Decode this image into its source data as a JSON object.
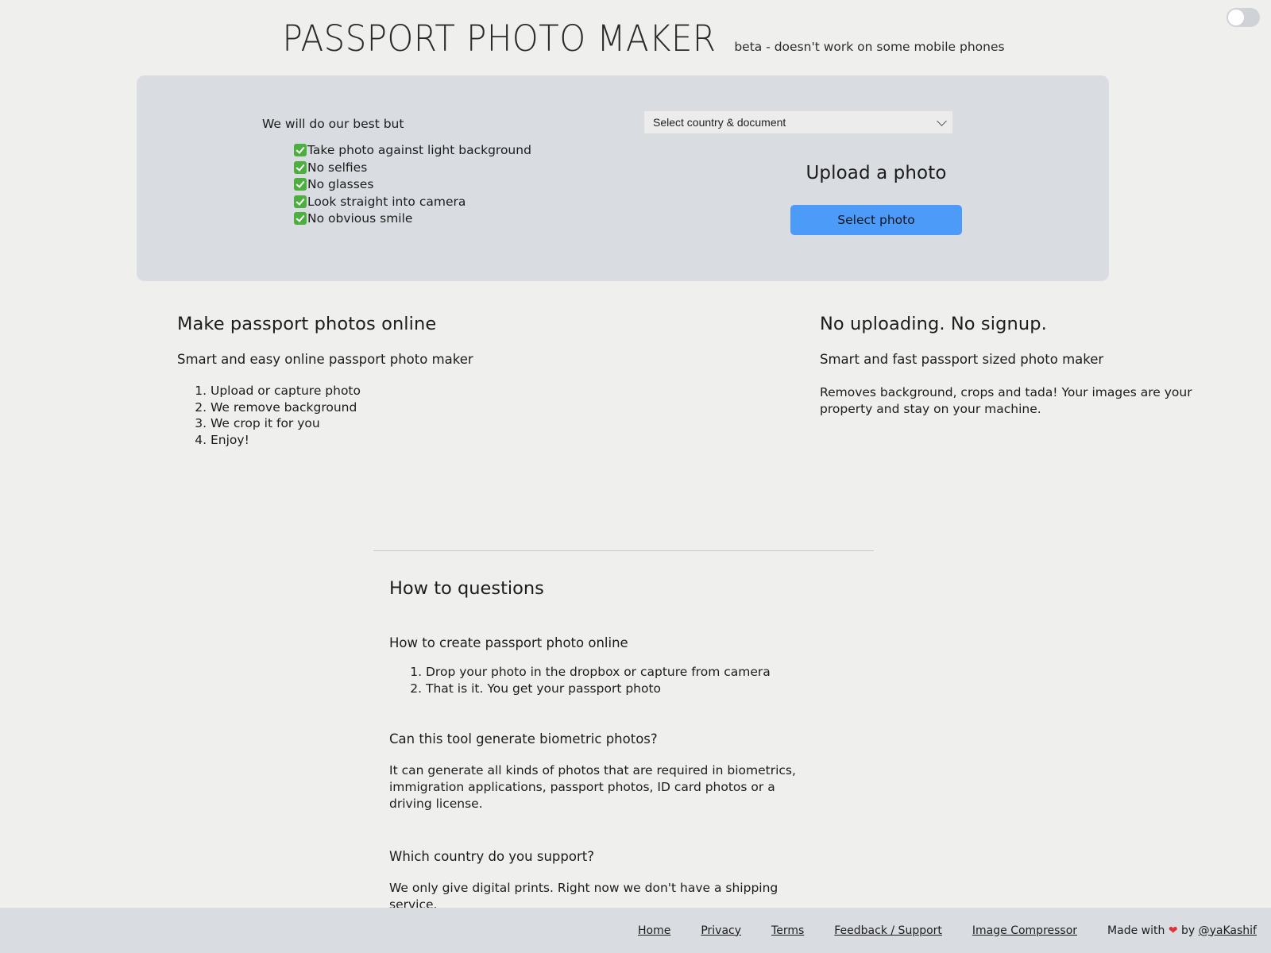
{
  "header": {
    "title": "PASSPORT PHOTO MAKER",
    "beta_note": "beta - doesn't work on some mobile phones"
  },
  "theme_toggle": {
    "name": "dark-mode-toggle",
    "state": "off"
  },
  "hero": {
    "best_label": "We will do our best but",
    "checklist": [
      "Take photo against light background",
      "No selfies",
      "No glasses",
      "Look straight into camera",
      "No obvious smile"
    ],
    "country_select": {
      "value": "Select country & document",
      "options": [
        "Select country & document"
      ]
    },
    "upload_title": "Upload a photo",
    "select_photo_label": "Select photo"
  },
  "columns": [
    {
      "heading": "Make passport photos online",
      "subheading": "Smart and easy online passport photo maker",
      "steps": [
        "Upload or capture photo",
        "We remove background",
        "We crop it for you",
        "Enjoy!"
      ]
    },
    {
      "heading": "No uploading. No signup.",
      "subheading": "Smart and fast passport sized photo maker",
      "paragraph": "Removes background, crops and tada! Your images are your property and stay on your machine."
    }
  ],
  "faq": {
    "heading": "How to questions",
    "items": [
      {
        "question": "How to create passport photo online",
        "steps": [
          "Drop your photo in the dropbox or capture from camera",
          "That is it. You get your passport photo"
        ]
      },
      {
        "question": "Can this tool generate biometric photos?",
        "answer": "It can generate all kinds of photos that are required in biometrics, immigration applications, passport photos, ID card photos or a driving license."
      },
      {
        "question": "Which country do you support?",
        "answer": "We only give digital prints. Right now we don't have a shipping service."
      }
    ]
  },
  "footer": {
    "links": [
      "Home",
      "Privacy",
      "Terms",
      "Feedback / Support",
      "Image Compressor"
    ],
    "made_with_prefix": "Made with ",
    "heart": "❤",
    "made_with_suffix": " by ",
    "author": "@yaKashif"
  },
  "colors": {
    "page_background": "#efefee",
    "panel_background": "#d9dce1",
    "accent_button": "#4d9bf8",
    "check_green": "#4caf3f",
    "heart_red": "#e0313a",
    "text": "#1c1c1c"
  }
}
